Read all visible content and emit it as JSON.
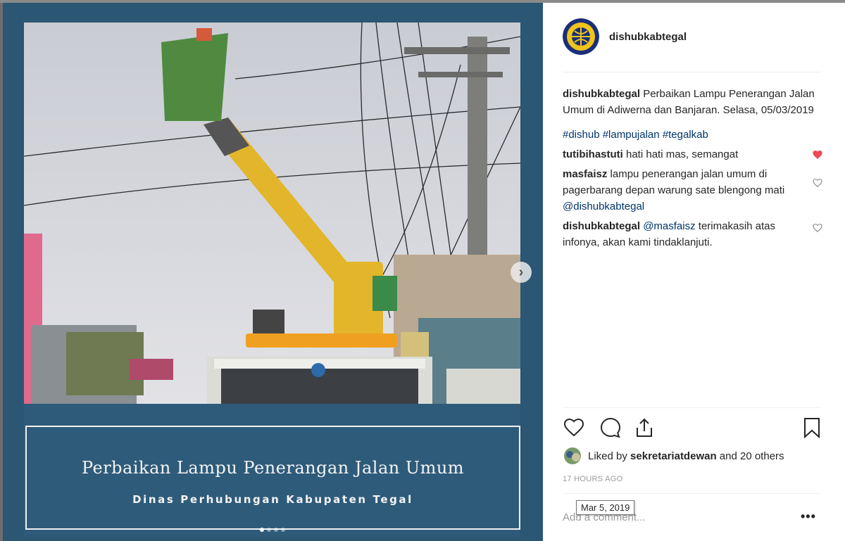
{
  "post": {
    "username": "dishubkabtegal",
    "caption": "Perbaikan Lampu Penerangan Jalan Umum di Adiwerna dan Banjaran. Selasa, 05/03/2019",
    "hashtags": "#dishub #lampujalan #tegalkab"
  },
  "image": {
    "banner_title": "Perbaikan Lampu Penerangan Jalan Umum",
    "banner_subtitle": "Dinas Perhubungan Kabupaten Tegal",
    "carousel_count": 4,
    "carousel_active": 1
  },
  "comments": [
    {
      "user": "tutibihastuti",
      "text": "hati hati mas, semangat",
      "mention": "",
      "liked": true
    },
    {
      "user": "masfaisz",
      "text": "lampu penerangan jalan umum di pagerbarang depan warung sate blengong mati",
      "mention": "@dishubkabtegal",
      "liked": false
    },
    {
      "user": "dishubkabtegal",
      "mention_first": "@masfaisz",
      "text": "terimakasih atas infonya, akan kami tindaklanjuti.",
      "liked": false
    }
  ],
  "likes": {
    "text_prefix": "Liked by",
    "user": "sekretariatdewan",
    "rest": "and 20 others"
  },
  "timestamp": "17 HOURS AGO",
  "tooltip": "Mar 5, 2019",
  "add_comment_placeholder": "Add a comment...",
  "colors": {
    "heart_liked": "#ed4956",
    "link": "#003569",
    "media_bg": "#2b5674"
  }
}
